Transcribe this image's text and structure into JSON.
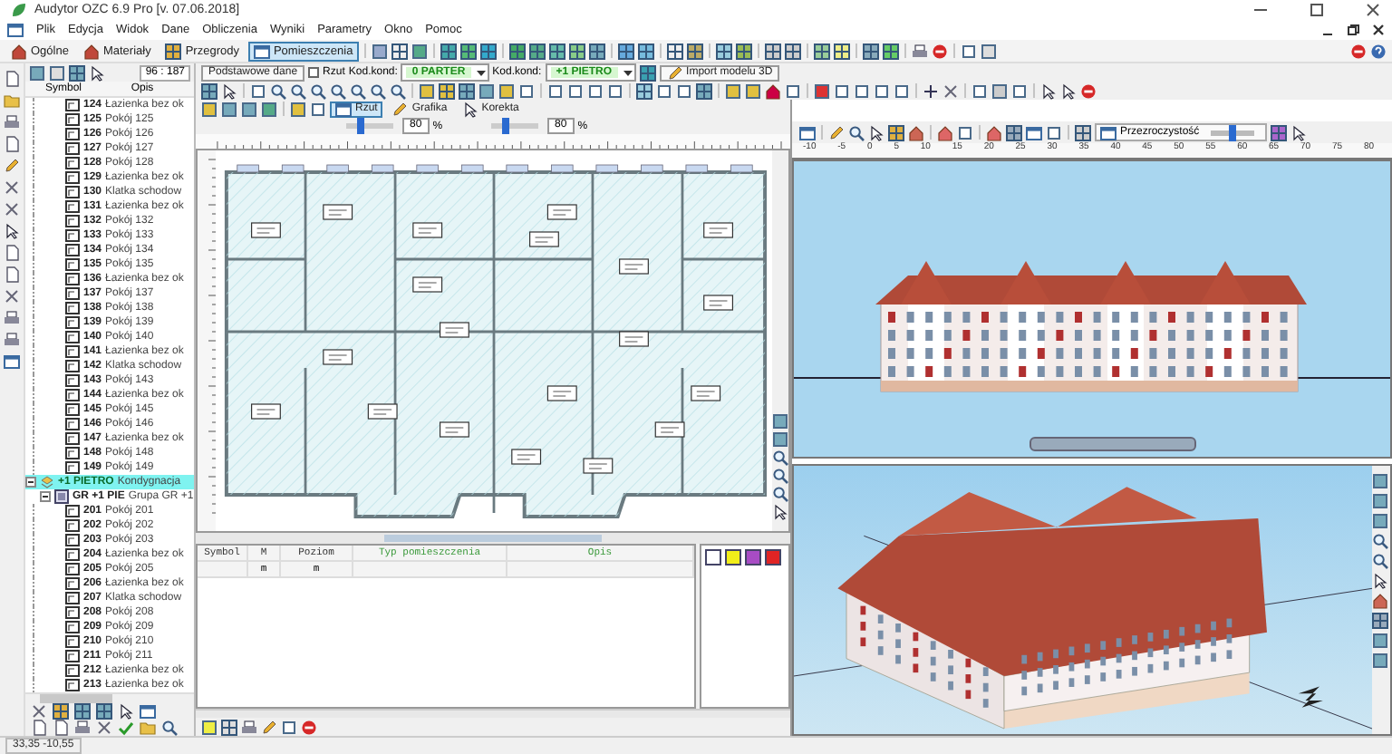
{
  "window": {
    "title": "Audytor OZC 6.9 Pro [v. 07.06.2018]"
  },
  "menu": [
    "Plik",
    "Edycja",
    "Widok",
    "Dane",
    "Obliczenia",
    "Wyniki",
    "Parametry",
    "Okno",
    "Pomoc"
  ],
  "tabs": [
    {
      "label": "Ogólne",
      "selected": false
    },
    {
      "label": "Materiały",
      "selected": false
    },
    {
      "label": "Przegrody",
      "selected": false
    },
    {
      "label": "Pomieszczenia",
      "selected": true
    }
  ],
  "tree": {
    "counter": "96 : 187",
    "columns": [
      "Symbol",
      "Opis"
    ],
    "rows": [
      {
        "kind": "room",
        "symbol": "124",
        "description": "Łazienka bez ok",
        "selected": false
      },
      {
        "kind": "room",
        "symbol": "125",
        "description": "Pokój 125",
        "selected": false
      },
      {
        "kind": "room",
        "symbol": "126",
        "description": "Pokój 126",
        "selected": false
      },
      {
        "kind": "room",
        "symbol": "127",
        "description": "Pokój 127",
        "selected": false
      },
      {
        "kind": "room",
        "symbol": "128",
        "description": "Pokój 128",
        "selected": false
      },
      {
        "kind": "room",
        "symbol": "129",
        "description": "Łazienka bez ok",
        "selected": false
      },
      {
        "kind": "room",
        "symbol": "130",
        "description": "Klatka schodow",
        "selected": false
      },
      {
        "kind": "room",
        "symbol": "131",
        "description": "Łazienka bez ok",
        "selected": false
      },
      {
        "kind": "room",
        "symbol": "132",
        "description": "Pokój 132",
        "selected": false
      },
      {
        "kind": "room",
        "symbol": "133",
        "description": "Pokój 133",
        "selected": false
      },
      {
        "kind": "room",
        "symbol": "134",
        "description": "Pokój 134",
        "selected": false
      },
      {
        "kind": "room",
        "symbol": "135",
        "description": "Pokój 135",
        "selected": false
      },
      {
        "kind": "room",
        "symbol": "136",
        "description": "Łazienka bez ok",
        "selected": false
      },
      {
        "kind": "room",
        "symbol": "137",
        "description": "Pokój 137",
        "selected": false
      },
      {
        "kind": "room",
        "symbol": "138",
        "description": "Pokój 138",
        "selected": false
      },
      {
        "kind": "room",
        "symbol": "139",
        "description": "Pokój 139",
        "selected": false
      },
      {
        "kind": "room",
        "symbol": "140",
        "description": "Pokój 140",
        "selected": false
      },
      {
        "kind": "room",
        "symbol": "141",
        "description": "Łazienka bez ok",
        "selected": false
      },
      {
        "kind": "room",
        "symbol": "142",
        "description": "Klatka schodow",
        "selected": false
      },
      {
        "kind": "room",
        "symbol": "143",
        "description": "Pokój 143",
        "selected": false
      },
      {
        "kind": "room",
        "symbol": "144",
        "description": "Łazienka bez ok",
        "selected": false
      },
      {
        "kind": "room",
        "symbol": "145",
        "description": "Pokój 145",
        "selected": false
      },
      {
        "kind": "room",
        "symbol": "146",
        "description": "Pokój 146",
        "selected": false
      },
      {
        "kind": "room",
        "symbol": "147",
        "description": "Łazienka bez ok",
        "selected": false
      },
      {
        "kind": "room",
        "symbol": "148",
        "description": "Pokój 148",
        "selected": false
      },
      {
        "kind": "room",
        "symbol": "149",
        "description": "Pokój 149",
        "selected": false
      },
      {
        "kind": "floor",
        "symbol": "+1 PIETRO",
        "description": "Kondygnacja",
        "selected": true
      },
      {
        "kind": "group",
        "symbol": "GR +1 PIE",
        "description": "Grupa GR +1",
        "selected": false
      },
      {
        "kind": "room",
        "symbol": "201",
        "description": "Pokój 201",
        "selected": false
      },
      {
        "kind": "room",
        "symbol": "202",
        "description": "Pokój 202",
        "selected": false
      },
      {
        "kind": "room",
        "symbol": "203",
        "description": "Pokój 203",
        "selected": false
      },
      {
        "kind": "room",
        "symbol": "204",
        "description": "Łazienka bez ok",
        "selected": false
      },
      {
        "kind": "room",
        "symbol": "205",
        "description": "Pokój 205",
        "selected": false
      },
      {
        "kind": "room",
        "symbol": "206",
        "description": "Łazienka bez ok",
        "selected": false
      },
      {
        "kind": "room",
        "symbol": "207",
        "description": "Klatka schodow",
        "selected": false
      },
      {
        "kind": "room",
        "symbol": "208",
        "description": "Pokój 208",
        "selected": false
      },
      {
        "kind": "room",
        "symbol": "209",
        "description": "Pokój 209",
        "selected": false
      },
      {
        "kind": "room",
        "symbol": "210",
        "description": "Pokój 210",
        "selected": false
      },
      {
        "kind": "room",
        "symbol": "211",
        "description": "Pokój 211",
        "selected": false
      },
      {
        "kind": "room",
        "symbol": "212",
        "description": "Łazienka bez ok",
        "selected": false
      },
      {
        "kind": "room",
        "symbol": "213",
        "description": "Łazienka bez ok",
        "selected": false
      }
    ]
  },
  "plan": {
    "basic_data_button": "Podstawowe dane",
    "view_check": {
      "label": "Rzut",
      "checked": false
    },
    "level_label_1": "Kod.kond:",
    "level_1": "0 PARTER",
    "level_label_2": "Kod.kond:",
    "level_2": "+1 PIETRO",
    "import_button": "Import modelu 3D",
    "modes": [
      {
        "label": "Rzut",
        "selected": true
      },
      {
        "label": "Grafika",
        "selected": false
      },
      {
        "label": "Korekta",
        "selected": false
      }
    ],
    "zooms": [
      {
        "value": "80",
        "unit": "%",
        "level": 0.3
      },
      {
        "value": "80",
        "unit": "%",
        "level": 0.3
      }
    ]
  },
  "table": {
    "columns": [
      {
        "label": "Symbol",
        "highlighted": false
      },
      {
        "label": "M",
        "unit": "m",
        "highlighted": false
      },
      {
        "label": "Poziom",
        "unit": "m",
        "highlighted": false
      },
      {
        "label": "Typ pomieszczenia",
        "highlighted": true
      },
      {
        "label": "Opis",
        "highlighted": true
      }
    ],
    "swatches": [
      {
        "color": "#ffffff"
      },
      {
        "color": "#f2ee1a"
      },
      {
        "color": "#a84cc4"
      },
      {
        "color": "#e02424"
      }
    ]
  },
  "view3d": {
    "transparency_label": "Przezroczystość",
    "transparency": {
      "level": 0.5
    },
    "ruler": [
      "-10",
      "-5",
      "0",
      "5",
      "10",
      "15",
      "20",
      "25",
      "30",
      "35",
      "40",
      "45",
      "50",
      "55",
      "60",
      "65",
      "70",
      "75",
      "80"
    ]
  },
  "status_bar": {
    "coordinates": "33,35 -10,55"
  }
}
